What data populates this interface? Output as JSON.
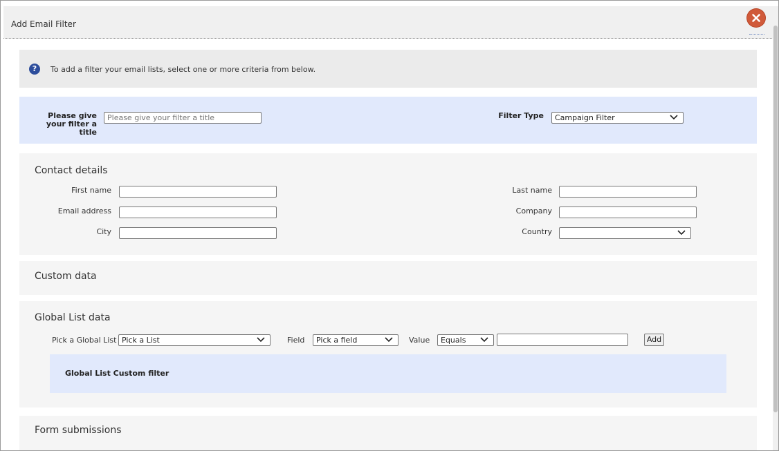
{
  "dialog": {
    "title": "Add Email Filter",
    "close_icon": "close-icon"
  },
  "info": {
    "icon": "help-icon",
    "icon_glyph": "?",
    "text": "To add a filter your email lists, select one or more criteria from below."
  },
  "filter_settings": {
    "title_label": "Please give your filter a title",
    "title_placeholder": "Please give your filter a title",
    "title_value": "",
    "type_label": "Filter Type",
    "type_value": "Campaign Filter"
  },
  "contact_details": {
    "heading": "Contact details",
    "first_name_label": "First name",
    "first_name_value": "",
    "email_label": "Email address",
    "email_value": "",
    "city_label": "City",
    "city_value": "",
    "last_name_label": "Last name",
    "last_name_value": "",
    "company_label": "Company",
    "company_value": "",
    "country_label": "Country",
    "country_value": ""
  },
  "custom_data": {
    "heading": "Custom data"
  },
  "global_list": {
    "heading": "Global List data",
    "pick_list_label": "Pick a Global List",
    "pick_list_value": "Pick a List",
    "field_label": "Field",
    "field_value": "Pick a field",
    "value_label": "Value",
    "operator_value": "Equals",
    "value_input": "",
    "add_label": "Add",
    "custom_filter_label": "Global List Custom filter"
  },
  "form_submissions": {
    "heading": "Form submissions"
  },
  "colors": {
    "close_button": "#d05a3a",
    "info_icon": "#2d4d9c",
    "highlight_panel": "#e1e9fc",
    "panel_bg": "#f5f5f5"
  }
}
